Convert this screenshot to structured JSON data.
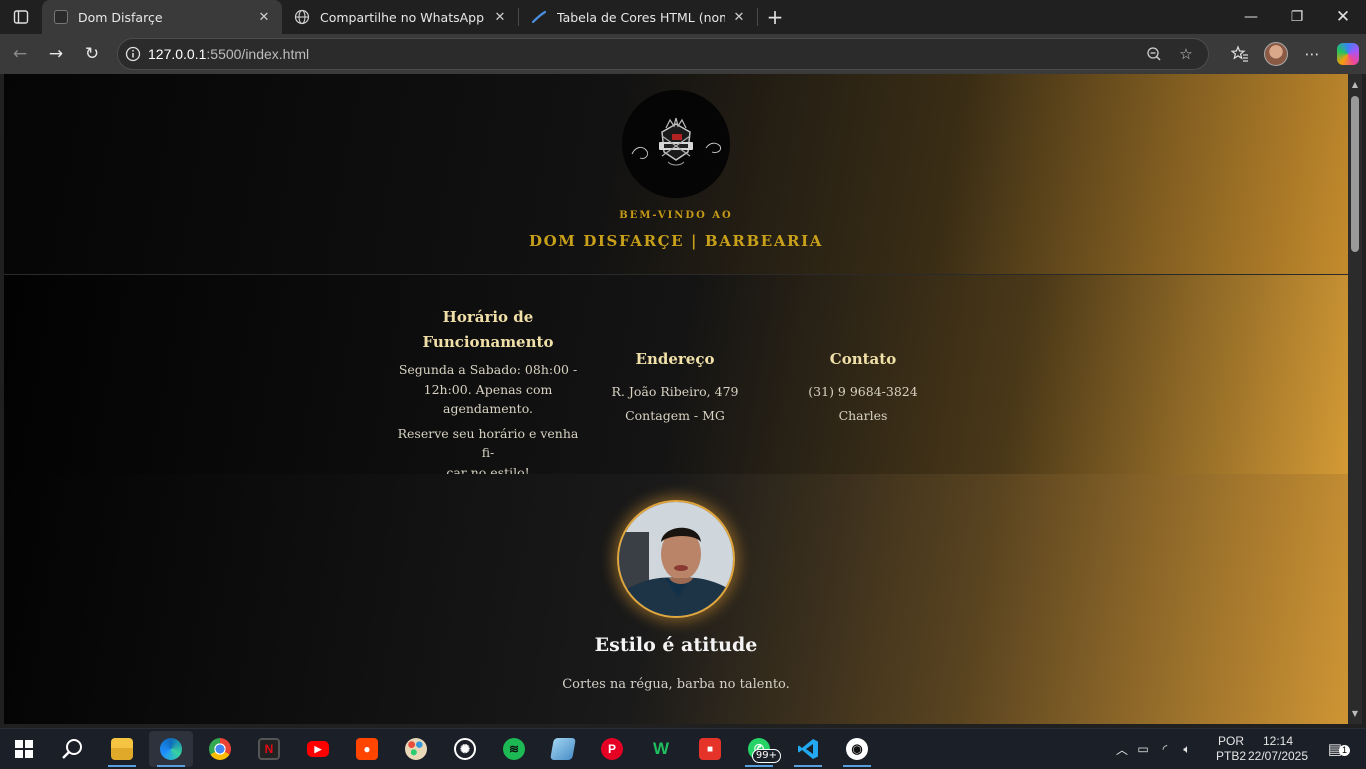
{
  "browser": {
    "tabs": [
      {
        "title": "Dom Disfarçe",
        "active": true
      },
      {
        "title": "Compartilhe no WhatsApp",
        "active": false
      },
      {
        "title": "Tabela de Cores HTML (nome, hex",
        "active": false
      }
    ],
    "url_host": "127.0.0.1",
    "url_rest": ":5500/index.html"
  },
  "page": {
    "welcome_small": "BEM-VINDO AO",
    "welcome_big": "DOM DISFARÇE | BARBEARIA",
    "hours": {
      "title_line1": "Horário de",
      "title_line2": "Funcionamento",
      "line1": "Segunda a Sabado: 08h:00 -",
      "line2": "12h:00. Apenas com",
      "line3": "agendamento.",
      "line4": "Reserve seu horário e venha fi-",
      "line5": "car no estilo!"
    },
    "address": {
      "title": "Endereço",
      "line1": "R. João Ribeiro, 479",
      "line2": "Contagem - MG"
    },
    "contact": {
      "title": "Contato",
      "phone": "(31) 9 9684-3824",
      "name": "Charles"
    },
    "headline": "Estilo é atitude",
    "tagline": "Cortes na régua, barba no talento."
  },
  "taskbar": {
    "whatsapp_badge": "99+",
    "language_line1": "POR",
    "language_line2": "PTB2",
    "time": "12:14",
    "date": "22/07/2025",
    "notification_count": "1"
  },
  "colors": {
    "accent_gold": "#c9a01a",
    "heading_cream": "#f0e0a8",
    "gradient_gold": "#d49a35"
  }
}
